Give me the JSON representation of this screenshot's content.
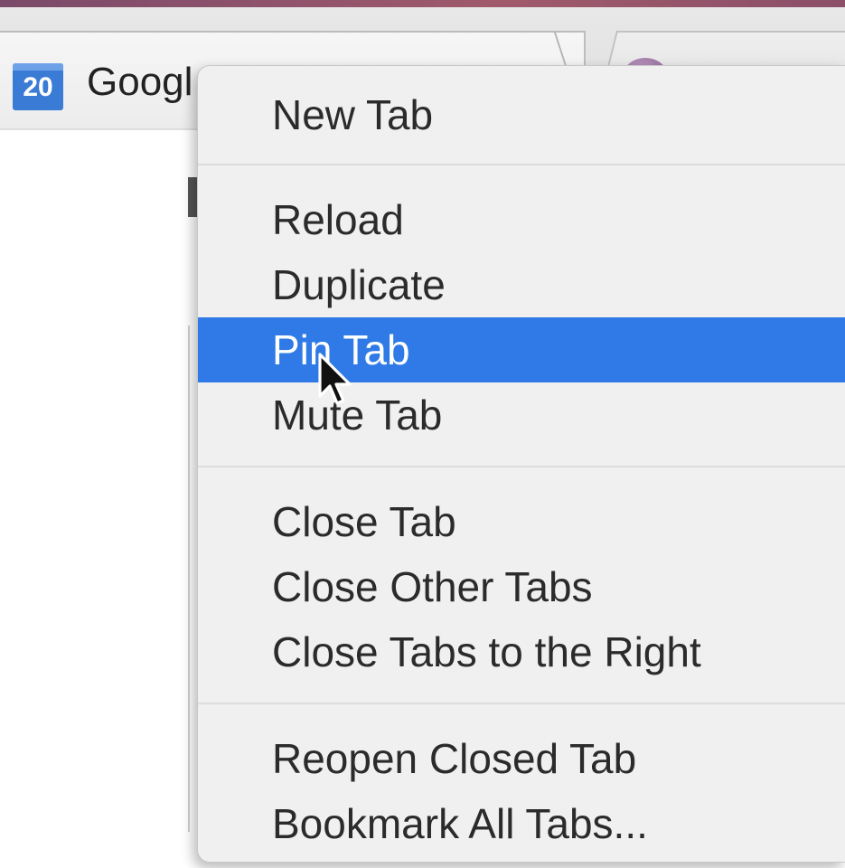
{
  "tabs": [
    {
      "favicon": "calendar-icon",
      "favicon_text": "20",
      "title": "Googl",
      "active": true
    },
    {
      "favicon": "generic-site-icon",
      "title": "",
      "active": false
    }
  ],
  "context_menu": {
    "groups": [
      [
        {
          "label": "New Tab"
        }
      ],
      [
        {
          "label": "Reload"
        },
        {
          "label": "Duplicate"
        },
        {
          "label": "Pin Tab",
          "highlighted": true
        },
        {
          "label": "Mute Tab"
        }
      ],
      [
        {
          "label": "Close Tab"
        },
        {
          "label": "Close Other Tabs"
        },
        {
          "label": "Close Tabs to the Right"
        }
      ],
      [
        {
          "label": "Reopen Closed Tab"
        },
        {
          "label": "Bookmark All Tabs..."
        }
      ]
    ]
  },
  "colors": {
    "highlight": "#2f7ae6",
    "menu_background": "#f0f0f0",
    "calendar_favicon": "#3a7bd5"
  },
  "cursor": "arrow-pointer-icon"
}
